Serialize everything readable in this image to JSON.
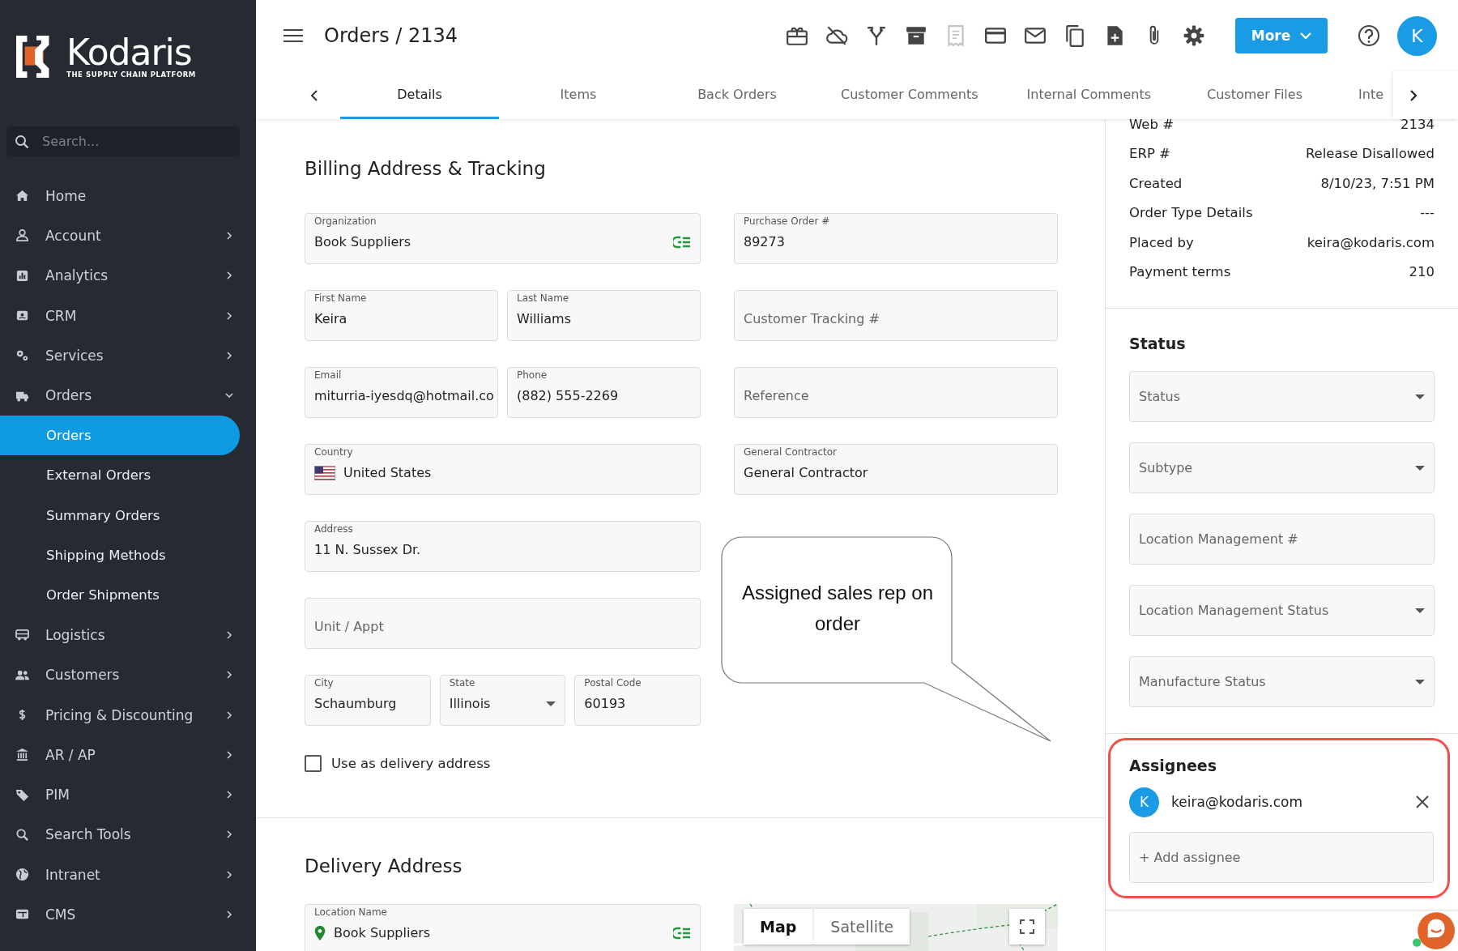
{
  "sidebar": {
    "logo": {
      "name": "Kodaris",
      "tagline": "THE SUPPLY CHAIN PLATFORM"
    },
    "search": {
      "placeholder": "Search..."
    },
    "items": [
      {
        "label": "Home",
        "kind": "link"
      },
      {
        "label": "Account",
        "kind": "group",
        "expanded": false
      },
      {
        "label": "Analytics",
        "kind": "group",
        "expanded": false
      },
      {
        "label": "CRM",
        "kind": "group",
        "expanded": false
      },
      {
        "label": "Services",
        "kind": "group",
        "expanded": false
      },
      {
        "label": "Orders",
        "kind": "group",
        "expanded": true,
        "children": [
          {
            "label": "Orders",
            "selected": true
          },
          {
            "label": "External Orders",
            "selected": false
          },
          {
            "label": "Summary Orders",
            "selected": false
          },
          {
            "label": "Shipping Methods",
            "selected": false
          },
          {
            "label": "Order Shipments",
            "selected": false
          }
        ]
      },
      {
        "label": "Logistics",
        "kind": "group",
        "expanded": false
      },
      {
        "label": "Customers",
        "kind": "group",
        "expanded": false
      },
      {
        "label": "Pricing & Discounting",
        "kind": "group",
        "expanded": false
      },
      {
        "label": "AR / AP",
        "kind": "group",
        "expanded": false
      },
      {
        "label": "PIM",
        "kind": "group",
        "expanded": false
      },
      {
        "label": "Search Tools",
        "kind": "group",
        "expanded": false
      },
      {
        "label": "Intranet",
        "kind": "group",
        "expanded": false
      },
      {
        "label": "CMS",
        "kind": "group",
        "expanded": false
      }
    ]
  },
  "header": {
    "breadcrumb": "Orders / 2134",
    "toolbar": [
      {
        "disabled": false
      },
      {
        "disabled": false
      },
      {
        "disabled": false
      },
      {
        "disabled": false
      },
      {
        "disabled": true
      },
      {
        "disabled": false
      },
      {
        "disabled": false
      },
      {
        "disabled": false
      },
      {
        "disabled": false
      },
      {
        "disabled": false
      },
      {
        "disabled": false
      }
    ],
    "more_button": "More",
    "avatar": "K"
  },
  "tabs": [
    {
      "label": "Details",
      "selected": true
    },
    {
      "label": "Items",
      "selected": false
    },
    {
      "label": "Back Orders",
      "selected": false
    },
    {
      "label": "Customer Comments",
      "selected": false
    },
    {
      "label": "Internal Comments",
      "selected": false
    },
    {
      "label": "Customer Files",
      "selected": false
    },
    {
      "label": "Inte",
      "selected": false
    }
  ],
  "billing": {
    "title": "Billing Address & Tracking",
    "left_rows": [
      [
        {
          "label": "Organization",
          "value": "Book Suppliers",
          "kind": "lookup"
        }
      ],
      [
        {
          "label": "First Name",
          "value": "Keira",
          "kind": "text"
        },
        {
          "label": "Last Name",
          "value": "Williams",
          "kind": "text"
        }
      ],
      [
        {
          "label": "Email",
          "value": "miturria-iyesdq@hotmail.co",
          "kind": "text"
        },
        {
          "label": "Phone",
          "value": "(882) 555-2269",
          "kind": "text"
        }
      ],
      [
        {
          "label": "Country",
          "value": "United States",
          "kind": "flag"
        }
      ],
      [
        {
          "label": "Address",
          "value": "11 N. Sussex Dr.",
          "kind": "text"
        }
      ],
      [
        {
          "placeholder": "Unit / Appt",
          "kind": "text"
        }
      ],
      [
        {
          "label": "City",
          "value": "Schaumburg",
          "kind": "text"
        },
        {
          "label": "State",
          "value": "Illinois",
          "kind": "select"
        },
        {
          "label": "Postal Code",
          "value": "60193",
          "kind": "text"
        }
      ]
    ],
    "right_fields": [
      {
        "label": "Purchase Order #",
        "value": "89273",
        "kind": "text"
      },
      {
        "placeholder": "Customer Tracking #",
        "kind": "text"
      },
      {
        "placeholder": "Reference",
        "kind": "text"
      },
      {
        "label": "General Contractor",
        "value": "General Contractor",
        "kind": "text"
      }
    ],
    "checkbox": {
      "label": "Use as delivery address",
      "checked": false
    }
  },
  "annotation": {
    "text": "Assigned sales rep on order"
  },
  "delivery": {
    "title": "Delivery Address",
    "field": {
      "label": "Location Name",
      "value": "Book Suppliers",
      "kind": "location"
    },
    "map": {
      "kind": "picture",
      "tabs": [
        {
          "label": "Map",
          "selected": true
        },
        {
          "label": "Satellite",
          "selected": false
        }
      ]
    }
  },
  "details": [
    {
      "label": "Web #",
      "value": "2134"
    },
    {
      "label": "ERP #",
      "value": "Release Disallowed"
    },
    {
      "label": "Created",
      "value": "8/10/23, 7:51 PM"
    },
    {
      "label": "Order Type Details",
      "value": "---"
    },
    {
      "label": "Placed by",
      "value": "keira@kodaris.com"
    },
    {
      "label": "Payment terms",
      "value": "210"
    }
  ],
  "status": {
    "title": "Status",
    "fields": [
      {
        "placeholder": "Status",
        "kind": "select"
      },
      {
        "placeholder": "Subtype",
        "kind": "select"
      },
      {
        "placeholder": "Location Management #",
        "kind": "text"
      },
      {
        "placeholder": "Location Management Status",
        "kind": "select"
      },
      {
        "placeholder": "Manufacture Status",
        "kind": "select"
      }
    ]
  },
  "assignees": {
    "title": "Assignees",
    "highlighted": true,
    "items": [
      {
        "initial": "K",
        "email": "keira@kodaris.com"
      }
    ],
    "add_placeholder": "+ Add assignee"
  }
}
